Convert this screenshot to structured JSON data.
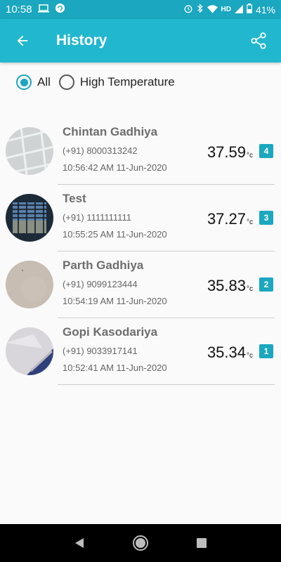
{
  "status": {
    "time": "10:58",
    "network": "HD",
    "battery": "41%"
  },
  "app_bar": {
    "title": "History",
    "back_icon": "arrow-left-icon",
    "share_icon": "share-icon"
  },
  "filters": {
    "selected": "All",
    "options": [
      "All",
      "High Temperature"
    ]
  },
  "records": [
    {
      "name": "Chintan Gadhiya",
      "phone": "(+91) 8000313242",
      "time": "10:56:42 AM 11-Jun-2020",
      "temp": "37.59",
      "unit": "°c",
      "badge": "4"
    },
    {
      "name": "Test",
      "phone": "(+91) 1111111111",
      "time": "10:55:25 AM 11-Jun-2020",
      "temp": "37.27",
      "unit": "°c",
      "badge": "3"
    },
    {
      "name": "Parth Gadhiya",
      "phone": "(+91) 9099123444",
      "time": "10:54:19 AM 11-Jun-2020",
      "temp": "35.83",
      "unit": "°c",
      "badge": "2"
    },
    {
      "name": "Gopi Kasodariya",
      "phone": "(+91) 9033917141",
      "time": "10:52:41 AM 11-Jun-2020",
      "temp": "35.34",
      "unit": "°c",
      "badge": "1"
    }
  ],
  "colors": {
    "primary": "#21b7cf",
    "status_bar": "#1aa7bf",
    "accent": "#1aa7bf"
  }
}
